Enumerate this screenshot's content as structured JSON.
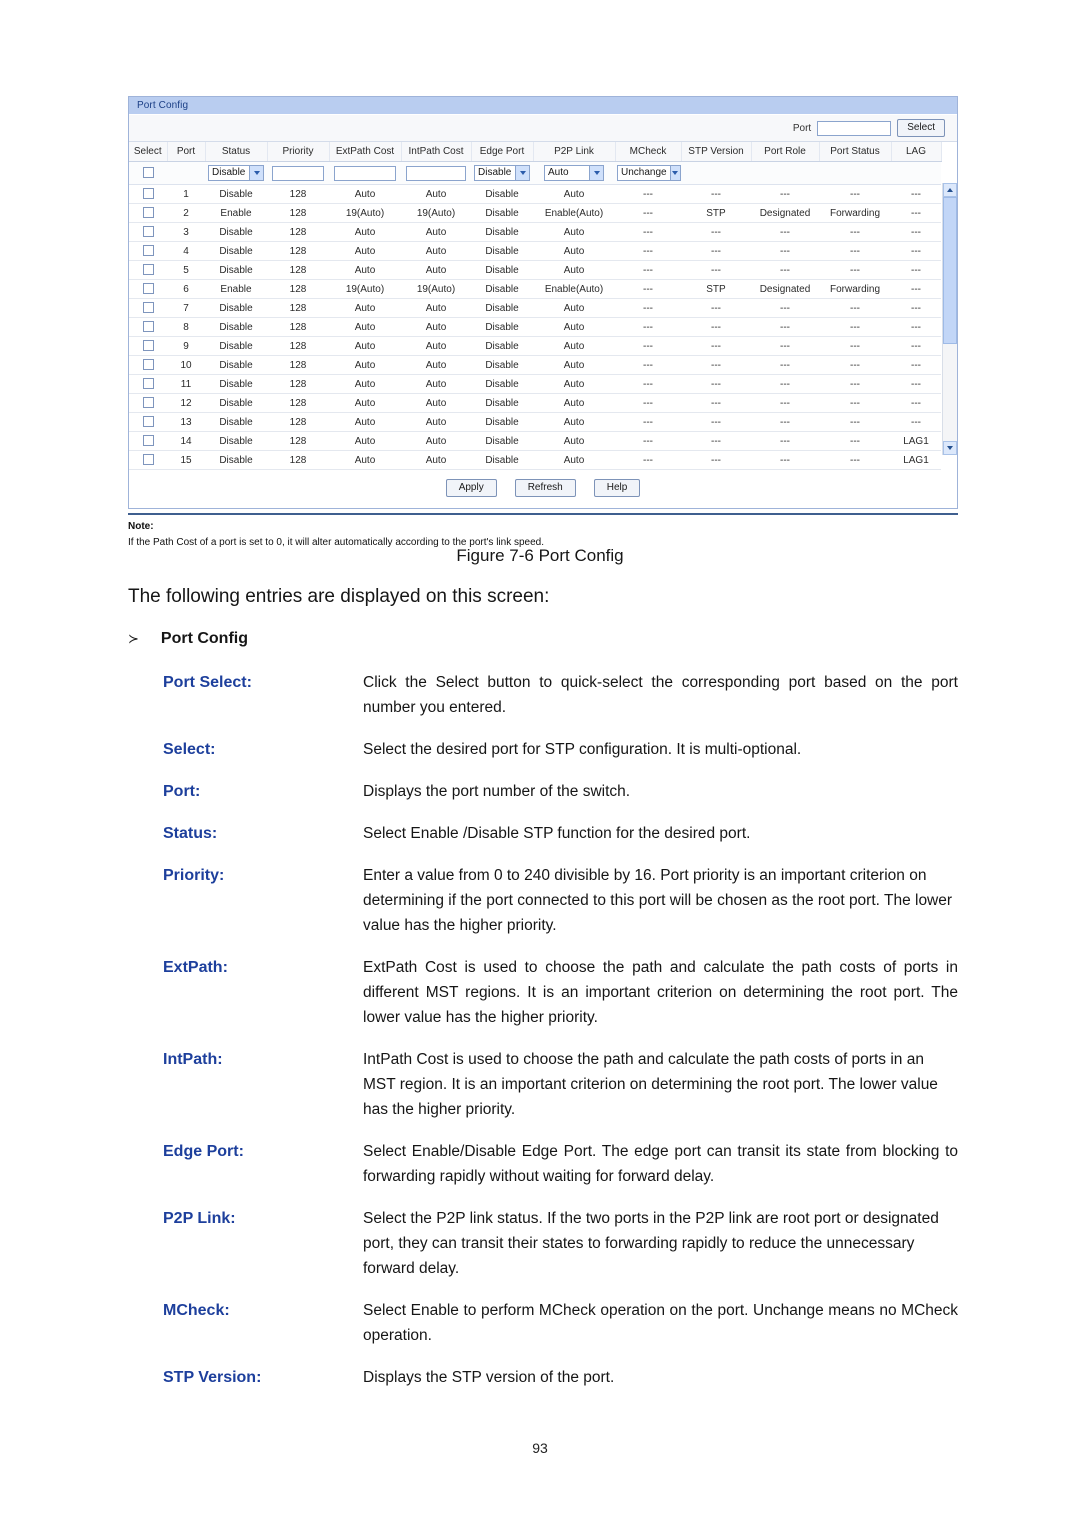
{
  "panel": {
    "title": "Port Config",
    "port_select": {
      "label": "Port",
      "value": "",
      "placeholder": "",
      "button": "Select"
    },
    "columns": [
      "Select",
      "Port",
      "Status",
      "Priority",
      "ExtPath Cost",
      "IntPath Cost",
      "Edge Port",
      "P2P Link",
      "MCheck",
      "STP Version",
      "Port Role",
      "Port Status",
      "LAG"
    ],
    "filter_row": {
      "status": "Disable",
      "priority": "",
      "extpath_cost": "",
      "intpath_cost": "",
      "edge_port": "Disable",
      "p2p_link": "Auto",
      "mcheck": "Unchange"
    },
    "rows": [
      {
        "port": "1",
        "status": "Disable",
        "priority": "128",
        "extpath": "Auto",
        "intpath": "Auto",
        "edge": "Disable",
        "p2p": "Auto",
        "mcheck": "---",
        "stp_version": "---",
        "port_role": "---",
        "port_status": "---",
        "lag": "---"
      },
      {
        "port": "2",
        "status": "Enable",
        "priority": "128",
        "extpath": "19(Auto)",
        "intpath": "19(Auto)",
        "edge": "Disable",
        "p2p": "Enable(Auto)",
        "mcheck": "---",
        "stp_version": "STP",
        "port_role": "Designated",
        "port_status": "Forwarding",
        "lag": "---"
      },
      {
        "port": "3",
        "status": "Disable",
        "priority": "128",
        "extpath": "Auto",
        "intpath": "Auto",
        "edge": "Disable",
        "p2p": "Auto",
        "mcheck": "---",
        "stp_version": "---",
        "port_role": "---",
        "port_status": "---",
        "lag": "---"
      },
      {
        "port": "4",
        "status": "Disable",
        "priority": "128",
        "extpath": "Auto",
        "intpath": "Auto",
        "edge": "Disable",
        "p2p": "Auto",
        "mcheck": "---",
        "stp_version": "---",
        "port_role": "---",
        "port_status": "---",
        "lag": "---"
      },
      {
        "port": "5",
        "status": "Disable",
        "priority": "128",
        "extpath": "Auto",
        "intpath": "Auto",
        "edge": "Disable",
        "p2p": "Auto",
        "mcheck": "---",
        "stp_version": "---",
        "port_role": "---",
        "port_status": "---",
        "lag": "---"
      },
      {
        "port": "6",
        "status": "Enable",
        "priority": "128",
        "extpath": "19(Auto)",
        "intpath": "19(Auto)",
        "edge": "Disable",
        "p2p": "Enable(Auto)",
        "mcheck": "---",
        "stp_version": "STP",
        "port_role": "Designated",
        "port_status": "Forwarding",
        "lag": "---"
      },
      {
        "port": "7",
        "status": "Disable",
        "priority": "128",
        "extpath": "Auto",
        "intpath": "Auto",
        "edge": "Disable",
        "p2p": "Auto",
        "mcheck": "---",
        "stp_version": "---",
        "port_role": "---",
        "port_status": "---",
        "lag": "---"
      },
      {
        "port": "8",
        "status": "Disable",
        "priority": "128",
        "extpath": "Auto",
        "intpath": "Auto",
        "edge": "Disable",
        "p2p": "Auto",
        "mcheck": "---",
        "stp_version": "---",
        "port_role": "---",
        "port_status": "---",
        "lag": "---"
      },
      {
        "port": "9",
        "status": "Disable",
        "priority": "128",
        "extpath": "Auto",
        "intpath": "Auto",
        "edge": "Disable",
        "p2p": "Auto",
        "mcheck": "---",
        "stp_version": "---",
        "port_role": "---",
        "port_status": "---",
        "lag": "---"
      },
      {
        "port": "10",
        "status": "Disable",
        "priority": "128",
        "extpath": "Auto",
        "intpath": "Auto",
        "edge": "Disable",
        "p2p": "Auto",
        "mcheck": "---",
        "stp_version": "---",
        "port_role": "---",
        "port_status": "---",
        "lag": "---"
      },
      {
        "port": "11",
        "status": "Disable",
        "priority": "128",
        "extpath": "Auto",
        "intpath": "Auto",
        "edge": "Disable",
        "p2p": "Auto",
        "mcheck": "---",
        "stp_version": "---",
        "port_role": "---",
        "port_status": "---",
        "lag": "---"
      },
      {
        "port": "12",
        "status": "Disable",
        "priority": "128",
        "extpath": "Auto",
        "intpath": "Auto",
        "edge": "Disable",
        "p2p": "Auto",
        "mcheck": "---",
        "stp_version": "---",
        "port_role": "---",
        "port_status": "---",
        "lag": "---"
      },
      {
        "port": "13",
        "status": "Disable",
        "priority": "128",
        "extpath": "Auto",
        "intpath": "Auto",
        "edge": "Disable",
        "p2p": "Auto",
        "mcheck": "---",
        "stp_version": "---",
        "port_role": "---",
        "port_status": "---",
        "lag": "---"
      },
      {
        "port": "14",
        "status": "Disable",
        "priority": "128",
        "extpath": "Auto",
        "intpath": "Auto",
        "edge": "Disable",
        "p2p": "Auto",
        "mcheck": "---",
        "stp_version": "---",
        "port_role": "---",
        "port_status": "---",
        "lag": "LAG1"
      },
      {
        "port": "15",
        "status": "Disable",
        "priority": "128",
        "extpath": "Auto",
        "intpath": "Auto",
        "edge": "Disable",
        "p2p": "Auto",
        "mcheck": "---",
        "stp_version": "---",
        "port_role": "---",
        "port_status": "---",
        "lag": "LAG1"
      }
    ],
    "actions": {
      "apply": "Apply",
      "refresh": "Refresh",
      "help": "Help"
    },
    "note": {
      "title": "Note:",
      "body": "If the Path Cost of a port is set to 0, it will alter automatically according to the port's link speed."
    }
  },
  "document": {
    "figure_caption": "Figure 7-6 Port Config",
    "lead": "The following entries are displayed on this screen:",
    "section_bullet": "≻",
    "section_title": "Port Config",
    "entries": [
      {
        "term": "Port Select:",
        "desc": "Click the Select button to quick-select the corresponding port based on the port number you entered."
      },
      {
        "term": "Select:",
        "desc": "Select the desired port for STP configuration. It is multi-optional."
      },
      {
        "term": "Port:",
        "desc": "Displays the port number of the switch."
      },
      {
        "term": "Status:",
        "desc": "Select Enable /Disable STP function for the desired port."
      },
      {
        "term": "Priority:",
        "desc": "Enter a value from 0 to 240 divisible by 16. Port priority is an important criterion on determining if the port connected to this port will be chosen as the root port. The lower value has the higher priority."
      },
      {
        "term": "ExtPath:",
        "desc": "ExtPath Cost is used to choose the path and calculate the path costs of ports in different MST regions. It is an important criterion on determining the root port. The lower value has the higher priority."
      },
      {
        "term": "IntPath:",
        "desc": "IntPath Cost is used to choose the path and calculate the path costs of ports in an MST region. It is an important criterion on determining the root port. The lower value has the higher priority."
      },
      {
        "term": "Edge Port:",
        "desc": "Select Enable/Disable Edge Port. The edge port can transit its state from blocking to forwarding rapidly without waiting for forward delay."
      },
      {
        "term": "P2P Link:",
        "desc": "Select the P2P link status. If the two ports in the P2P link are root port or designated port, they can transit their states to forwarding rapidly to reduce the unnecessary forward delay."
      },
      {
        "term": "MCheck:",
        "desc": "Select Enable to perform MCheck operation on the port. Unchange means no MCheck operation."
      },
      {
        "term": "STP Version:",
        "desc": "Displays the STP version of the port."
      }
    ],
    "page_number": "93"
  },
  "colors": {
    "panel_title_bg": "#b9cdf0",
    "panel_title_fg": "#1b3f86",
    "term_blue": "#1d3f9c",
    "rule": "#3f5f8f"
  }
}
